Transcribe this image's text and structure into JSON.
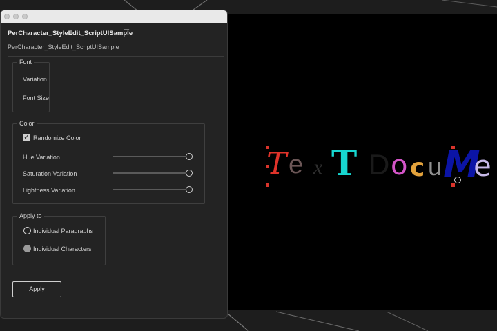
{
  "window": {
    "tab_title": "PerCharacter_StyleEdit_ScriptUISample",
    "panel_title": "PerCharacter_StyleEdit_ScriptUISample",
    "menu_icon": "hamburger-menu-icon"
  },
  "font_group": {
    "legend": "Font",
    "variation_label": "Variation",
    "font_size_label": "Font Size"
  },
  "color_group": {
    "legend": "Color",
    "randomize_label": "Randomize Color",
    "randomize_checked": true,
    "sliders": [
      {
        "label": "Hue Variation",
        "value": 1.0
      },
      {
        "label": "Saturation Variation",
        "value": 1.0
      },
      {
        "label": "Lightness Variation",
        "value": 1.0
      }
    ]
  },
  "apply_group": {
    "legend": "Apply to",
    "options": [
      {
        "label": "Individual Paragraphs",
        "selected": false
      },
      {
        "label": "Individual Characters",
        "selected": true
      }
    ]
  },
  "apply_button": "Apply",
  "preview": {
    "chars": [
      "T",
      "e",
      "x",
      "T",
      "D",
      "o",
      "c",
      "u",
      "M",
      "e"
    ],
    "colors": [
      "#e0332a",
      "#6b5656",
      "#2e2e2e",
      "#17d6d0",
      "#1a1a1a",
      "#d455c8",
      "#e3a23c",
      "#8f8f8f",
      "#0b14a6",
      "#c7b9e8"
    ]
  }
}
